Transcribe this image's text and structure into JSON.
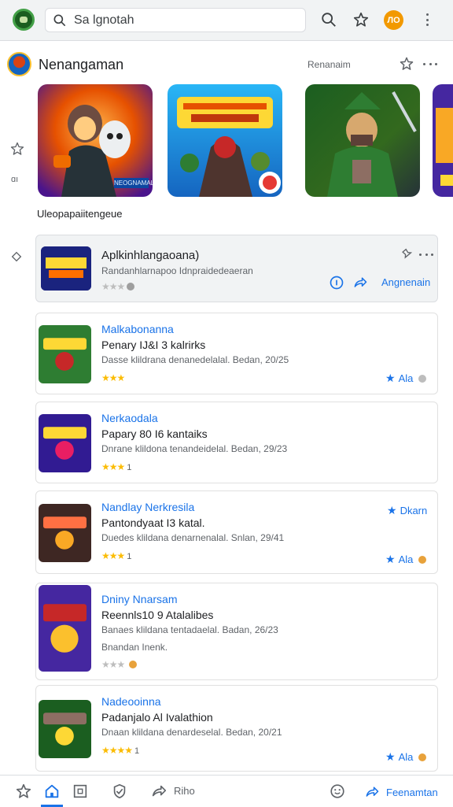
{
  "search": {
    "query": "Sa lgnotah"
  },
  "top_avatar": "ЛО",
  "profile": {
    "name": "Nenangaman",
    "subtitle": "Renanaim"
  },
  "hero_band": "NEOGNAMAL",
  "side_label": "ɑı",
  "section_label": "Uleopapaiitengeue",
  "featured": {
    "title": "Aplkinhlangaoana)",
    "meta": "Randanhlarnapoo  Idnpraidedeaeran",
    "action": "Angnenain",
    "thumb_text": "SNIKK RAIZER"
  },
  "cards": [
    {
      "category": "Malkabonanna",
      "title": "Penary IJ&I 3 kalrirks",
      "meta": "Dasse klildrana denanedelalal. Bedan,  20/25",
      "stars": 3,
      "rating": "",
      "action": "Ala"
    },
    {
      "category": "Nerkaodala",
      "title": "Papary 80 I6 kantaiks",
      "meta": "Dnrane klildona tenandeidelal. Bedan,  29/23",
      "stars": 3,
      "rating": "1",
      "action": ""
    },
    {
      "category": "Nandlay Nerkresila",
      "title": "Pantondyaat I3 katal.",
      "meta": "Duedes klildana denarnenalal. Snlan,  29/41",
      "stars": 3,
      "rating": "1",
      "top_action": "Dkarn",
      "action": "Ala"
    },
    {
      "category": "Dniny Nnarsam",
      "title": "Reennls10 9 Atalalibes",
      "meta": "Banaes klildana tentadaelal. Badan,  26/23",
      "extra": "Bnandan Inenk.",
      "stars": 3,
      "rating": "",
      "action": ""
    },
    {
      "category": "Nadeooinna",
      "title": "Padanjalo Al Ivalathion",
      "meta": "Dnaan klildana denardeselal. Bedan,  20/21",
      "stars": 4,
      "rating": "1",
      "action": "Ala"
    }
  ],
  "bottom": {
    "label": "Riho",
    "cta": "Feenamtan"
  },
  "colors": {
    "accent": "#1a73e8",
    "star": "#fbbc04",
    "topbar": "#f1f3f4"
  }
}
